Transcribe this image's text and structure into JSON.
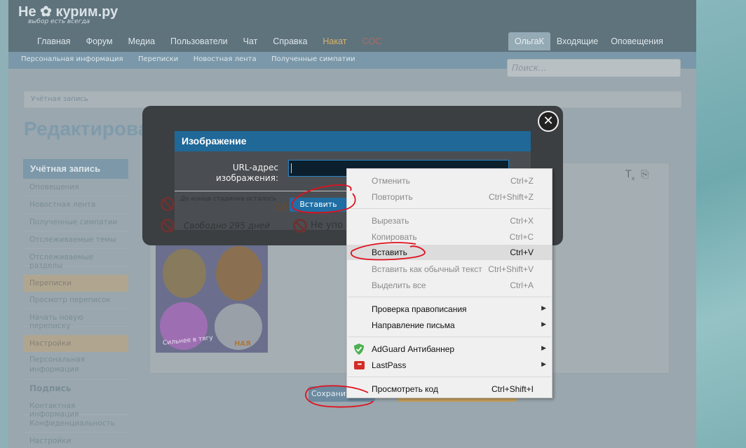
{
  "site": {
    "logo": "Не ✿ курим.ру",
    "tagline": "выбор есть всегда",
    "nav": [
      "Главная",
      "Форум",
      "Медиа",
      "Пользователи",
      "Чат",
      "Справка",
      "Накат",
      "СОС"
    ],
    "nav_right": [
      "ОльгаК",
      "Входящие",
      "Оповещения"
    ],
    "subnav": [
      "Персональная информация",
      "Переписки",
      "Новостная лента",
      "Полученные симпатии"
    ],
    "search_placeholder": "Поиск...",
    "breadcrumb": "Учётная запись",
    "page_title": "Редактировать подпись"
  },
  "sidebar": {
    "header": "Учётная запись",
    "items1": [
      "Оповещения",
      "Новостная лента",
      "Полученные симпатии",
      "Отслеживаемые темы",
      "Отслеживаемые разделы"
    ],
    "sec1": "Переписки",
    "items2": [
      "Просмотр переписок",
      "Начать новую переписку"
    ],
    "sec2": "Настройки",
    "item_personal": "Персональная информация",
    "item_signature": "Подпись",
    "items3": [
      "Контактная информация",
      "Конфиденциальность",
      "Настройки"
    ]
  },
  "editor": {
    "ghost1": "До конца стадиона осталось",
    "ghost2": "Свободно 295 дней",
    "ghost3": "Не упо",
    "ghost4": "Сб",
    "card_text1": "Сильнее в тягу",
    "card_text2": "НАЯ"
  },
  "bottom": {
    "save": "Сохранить"
  },
  "dialog": {
    "title": "Изображение",
    "url_label": "URL-адрес изображения:",
    "url_value": "",
    "insert_button": "Вставить",
    "close": "✕"
  },
  "context_menu": {
    "items": [
      {
        "label": "Отменить",
        "shortcut": "Ctrl+Z",
        "enabled": false
      },
      {
        "label": "Повторить",
        "shortcut": "Ctrl+Shift+Z",
        "enabled": false
      },
      {
        "label": "Вырезать",
        "shortcut": "Ctrl+X",
        "enabled": false
      },
      {
        "label": "Копировать",
        "shortcut": "Ctrl+C",
        "enabled": false
      },
      {
        "label": "Вставить",
        "shortcut": "Ctrl+V",
        "enabled": true,
        "highlighted": true
      },
      {
        "label": "Вставить как обычный текст",
        "shortcut": "Ctrl+Shift+V",
        "enabled": false
      },
      {
        "label": "Выделить все",
        "shortcut": "Ctrl+A",
        "enabled": false
      },
      {
        "label": "Проверка правописания",
        "shortcut": "",
        "enabled": true,
        "submenu": true
      },
      {
        "label": "Направление письма",
        "shortcut": "",
        "enabled": true,
        "submenu": true
      },
      {
        "label": "AdGuard Антибаннер",
        "shortcut": "",
        "enabled": true,
        "submenu": true,
        "icon": "adguard-shield-icon"
      },
      {
        "label": "LastPass",
        "shortcut": "",
        "enabled": true,
        "submenu": true,
        "icon": "lastpass-icon"
      },
      {
        "label": "Просмотреть код",
        "shortcut": "Ctrl+Shift+I",
        "enabled": true
      }
    ]
  },
  "colors": {
    "dialog_title_bg": "#1f6898",
    "annotation_red": "#e0101e",
    "lastpass_red": "#d32d27",
    "adguard_green": "#4caf50"
  }
}
